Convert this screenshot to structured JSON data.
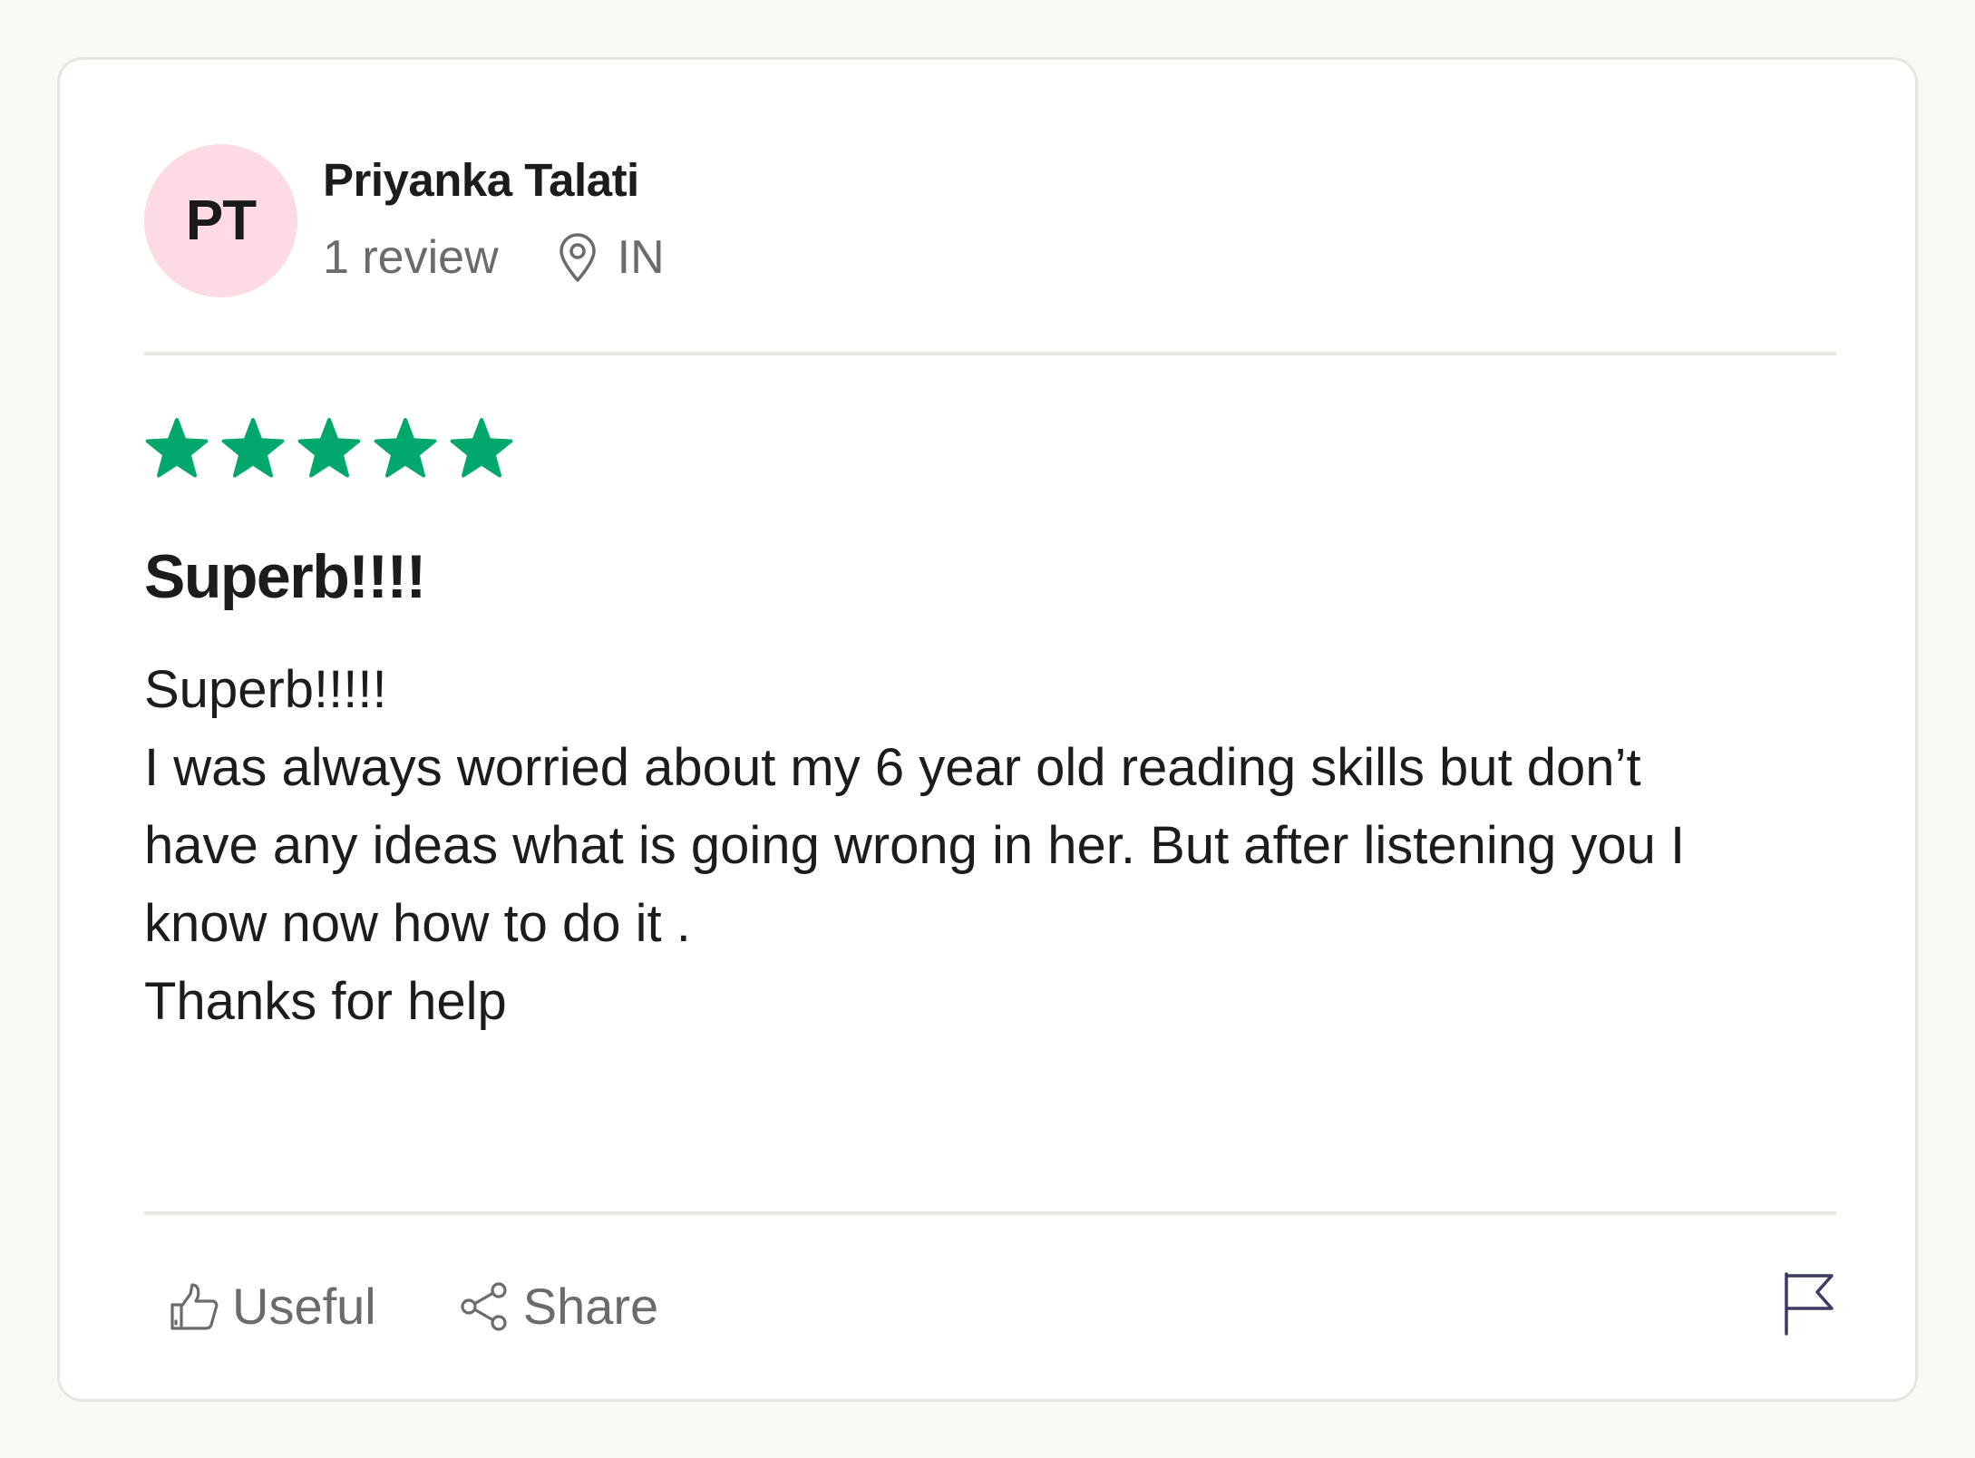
{
  "reviewer": {
    "initials": "PT",
    "name": "Priyanka Talati",
    "review_count": "1 review",
    "location": "IN"
  },
  "review": {
    "rating": 5,
    "rating_max": 5,
    "star_color": "#00a86b",
    "title": "Superb!!!!",
    "body_lines": [
      "Superb!!!!!",
      "I was always worried about my 6 year old reading skills but don’t",
      "have any ideas what is going wrong in her. But after listening you I",
      "know now how to do it .",
      "Thanks for help"
    ]
  },
  "actions": {
    "useful_label": "Useful",
    "share_label": "Share"
  },
  "icons": {
    "location": "location-pin-icon",
    "useful": "thumbs-up-icon",
    "share": "share-icon",
    "report": "flag-icon"
  }
}
